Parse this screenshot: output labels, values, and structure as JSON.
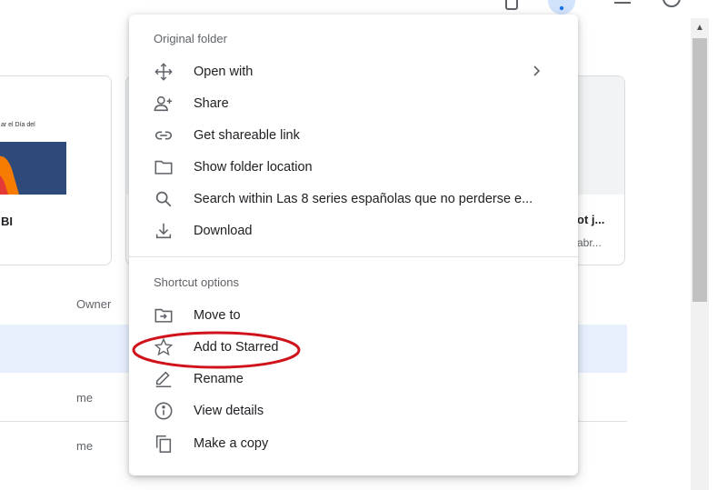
{
  "menu": {
    "section1_label": "Original folder",
    "items1": [
      {
        "label": "Open with",
        "icon": "open-with-icon",
        "has_submenu": true
      },
      {
        "label": "Share",
        "icon": "person-add-icon"
      },
      {
        "label": "Get shareable link",
        "icon": "link-icon"
      },
      {
        "label": "Show folder location",
        "icon": "folder-icon"
      },
      {
        "label": "Search within Las 8 series españolas que no perderse e...",
        "icon": "search-icon"
      },
      {
        "label": "Download",
        "icon": "download-icon"
      }
    ],
    "section2_label": "Shortcut options",
    "items2": [
      {
        "label": "Move to",
        "icon": "move-to-icon"
      },
      {
        "label": "Add to Starred",
        "icon": "star-icon",
        "annotated": true
      },
      {
        "label": "Rename",
        "icon": "pencil-icon"
      },
      {
        "label": "View details",
        "icon": "info-icon"
      },
      {
        "label": "Make a copy",
        "icon": "copy-icon"
      }
    ]
  },
  "background": {
    "cards": [
      {
        "thumb_text": "ar el Día del",
        "title": "BI"
      },
      {
        "title": "ot j...",
        "subtitle": "abr..."
      }
    ],
    "owner_header": "Owner",
    "rows": [
      {
        "owner": ""
      },
      {
        "owner": "me"
      },
      {
        "owner": "me"
      }
    ]
  },
  "colors": {
    "annotation": "#d0121b",
    "selected_row": "#e8f0fe",
    "icon": "#5f6368"
  }
}
